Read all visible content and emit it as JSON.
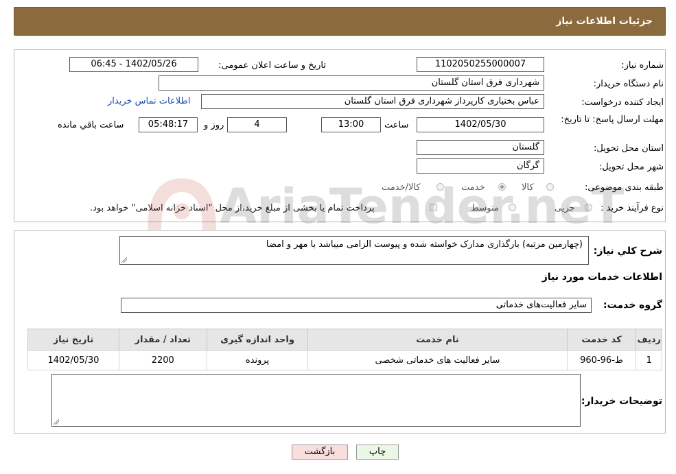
{
  "header": {
    "title": "جزئیات اطلاعات نیاز"
  },
  "form": {
    "need_number": {
      "label": "شماره نیاز:",
      "value": "1102050255000007"
    },
    "announce_datetime": {
      "label": "تاریخ و ساعت اعلان عمومی:",
      "value": "1402/05/26 - 06:45"
    },
    "buyer_org": {
      "label": "نام دستگاه خریدار:",
      "value": "شهرداری فرق استان گلستان"
    },
    "requester": {
      "label": "ایجاد کننده درخواست:",
      "value": "عباس بختیاری کارپرداز شهرداری فرق استان گلستان"
    },
    "buyer_contact_link": "اطلاعات تماس خریدار",
    "deadline": {
      "label": "مهلت ارسال پاسخ: تا تاریخ:",
      "date": "1402/05/30",
      "time_label": "ساعت",
      "time": "13:00",
      "days": "4",
      "days_label": "روز و",
      "remaining": "05:48:17",
      "remaining_label": "ساعت باقي مانده"
    },
    "delivery_province": {
      "label": "استان محل تحویل:",
      "value": "گلستان"
    },
    "delivery_city": {
      "label": "شهر محل تحویل:",
      "value": "گرگان"
    },
    "category": {
      "label": "طبقه بندی موضوعی:",
      "options": [
        "کالا",
        "خدمت",
        "کالا/خدمت"
      ],
      "selected": "خدمت"
    },
    "purchase_process": {
      "label": "نوع فرآیند خرید :",
      "options": [
        "جزیی",
        "متوسط"
      ],
      "note": "پرداخت تمام یا بخشی از مبلغ خرید،از محل \"اسناد خزانه اسلامی\" خواهد بود."
    }
  },
  "description": {
    "label": "شرح کلي نياز:",
    "value": "(چهارمین مرتبه) بارگذاری مدارک خواسته شده و پیوست الزامی میباشد با مهر و امضا"
  },
  "services": {
    "title": "اطلاعات خدمات مورد نياز",
    "group_label": "گروه خدمت:",
    "group_value": "سایر فعالیت‌های خدماتی",
    "table": {
      "headers": [
        "رديف",
        "کد خدمت",
        "نام خدمت",
        "واحد اندازه گيری",
        "تعداد / مقدار",
        "تاريخ نياز"
      ],
      "rows": [
        [
          "1",
          "ط-96-960",
          "سایر فعالیت های خدماتی شخصی",
          "پرونده",
          "2200",
          "1402/05/30"
        ]
      ]
    }
  },
  "buyer_notes": {
    "label": "توضيحات خريدار:",
    "value": ""
  },
  "buttons": {
    "print": "چاپ",
    "back": "بازگشت"
  },
  "watermark": "AriaTender.neT",
  "colors": {
    "header_bg": "#8b6a3e",
    "link": "#1a4fb5",
    "back_btn": "#f9dede",
    "print_btn": "#e9f7e4"
  }
}
